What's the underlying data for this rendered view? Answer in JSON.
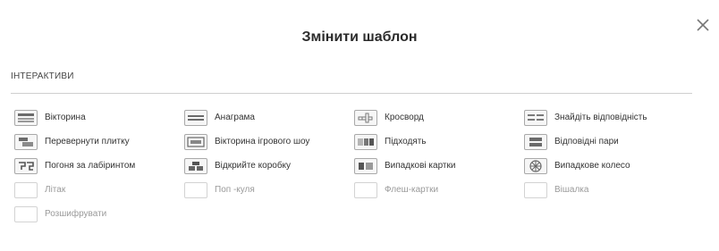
{
  "dialog": {
    "title": "Змінити шаблон",
    "close_icon": "close-icon"
  },
  "section": {
    "label": "ІНТЕРАКТИВИ"
  },
  "templates": [
    {
      "label": "Вікторина",
      "icon": "quiz-icon",
      "enabled": true
    },
    {
      "label": "Анаграма",
      "icon": "anagram-icon",
      "enabled": true
    },
    {
      "label": "Кросворд",
      "icon": "crossword-icon",
      "enabled": true
    },
    {
      "label": "Знайдіть відповідність",
      "icon": "match-up-icon",
      "enabled": true
    },
    {
      "label": "Перевернути плитку",
      "icon": "flip-tiles-icon",
      "enabled": true
    },
    {
      "label": "Вікторина ігрового шоу",
      "icon": "gameshow-quiz-icon",
      "enabled": true
    },
    {
      "label": "Підходять",
      "icon": "match-icon",
      "enabled": true
    },
    {
      "label": "Відповідні пари",
      "icon": "matching-pairs-icon",
      "enabled": true
    },
    {
      "label": "Погоня за лабіринтом",
      "icon": "maze-chase-icon",
      "enabled": true
    },
    {
      "label": "Відкрийте коробку",
      "icon": "open-box-icon",
      "enabled": true
    },
    {
      "label": "Випадкові картки",
      "icon": "random-cards-icon",
      "enabled": true
    },
    {
      "label": "Випадкове колесо",
      "icon": "spin-wheel-icon",
      "enabled": true
    },
    {
      "label": "Літак",
      "icon": "airplane-icon",
      "enabled": false
    },
    {
      "label": "Поп -куля",
      "icon": "balloon-pop-icon",
      "enabled": false
    },
    {
      "label": "Флеш-картки",
      "icon": "flash-cards-icon",
      "enabled": false
    },
    {
      "label": "Вішалка",
      "icon": "hangman-icon",
      "enabled": false
    },
    {
      "label": "Розшифрувати",
      "icon": "unjumble-icon",
      "enabled": false
    }
  ]
}
